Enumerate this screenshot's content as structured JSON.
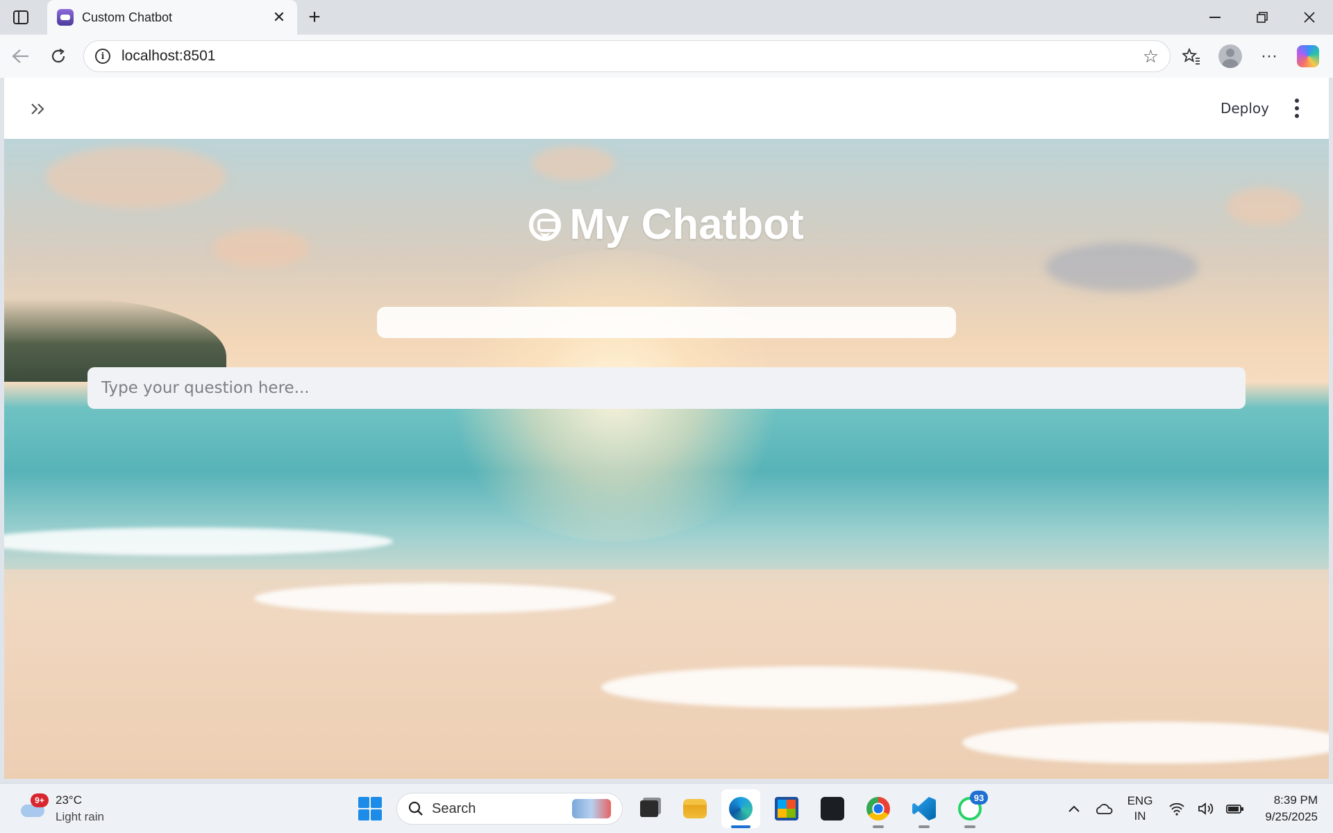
{
  "browser": {
    "tab_title": "Custom Chatbot",
    "new_tab_symbol": "+",
    "url": "localhost:8501"
  },
  "app": {
    "title": "My Chatbot",
    "deploy_label": "Deploy",
    "question_placeholder": "Type your question here..."
  },
  "taskbar": {
    "weather": {
      "temperature": "23°C",
      "condition": "Light rain",
      "badge": "9+"
    },
    "search_label": "Search",
    "whatsapp_badge": "93",
    "language": {
      "line1": "ENG",
      "line2": "IN"
    },
    "clock": {
      "time": "8:39 PM",
      "date": "9/25/2025"
    }
  },
  "colors": {
    "accent": "#1d6fd1",
    "input_bg": "#f0f2f6",
    "badge_red": "#d8262e"
  },
  "icons": [
    "tab-actions-icon",
    "close-tab-icon",
    "minimize-icon",
    "restore-icon",
    "close-window-icon",
    "back-icon",
    "refresh-icon",
    "site-info-icon",
    "favorite-star-icon",
    "favorites-icon",
    "profile-icon",
    "more-icon",
    "copilot-icon",
    "sidebar-expand-icon",
    "kebab-menu-icon",
    "windows-start-icon",
    "search-icon",
    "task-view-icon",
    "file-explorer-icon",
    "edge-icon",
    "store-icon",
    "github-icon",
    "chrome-icon",
    "vscode-icon",
    "whatsapp-icon",
    "chevron-up-icon",
    "onedrive-icon",
    "wifi-icon",
    "volume-icon",
    "battery-icon"
  ]
}
